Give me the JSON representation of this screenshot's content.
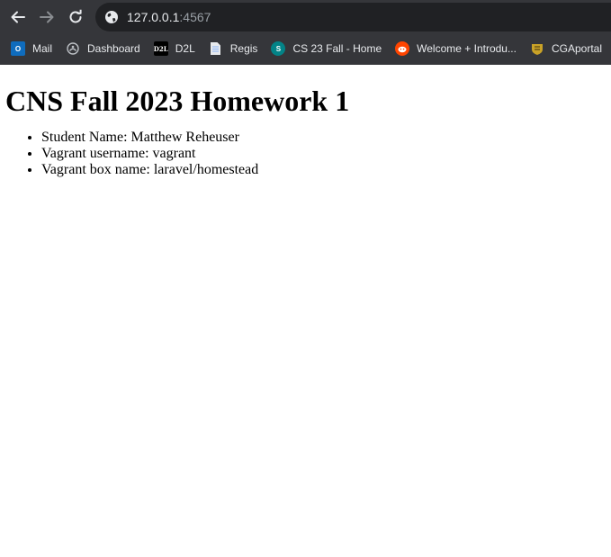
{
  "browser": {
    "url_host": "127.0.0.1",
    "url_port": ":4567",
    "bookmarks": [
      {
        "label": "Mail",
        "icon": "outlook-icon",
        "color": "#0f6cbd"
      },
      {
        "label": "Dashboard",
        "icon": "dashboard-icon",
        "color": "#bdc1c6"
      },
      {
        "label": "D2L",
        "icon": "d2l-icon",
        "color": "#000000"
      },
      {
        "label": "Regis",
        "icon": "document-icon",
        "color": "#8ab4f8"
      },
      {
        "label": "CS 23 Fall - Home",
        "icon": "sharepoint-icon",
        "color": "#038387"
      },
      {
        "label": "Welcome + Introdu...",
        "icon": "reddit-icon",
        "color": "#ff4500"
      },
      {
        "label": "CGAportal",
        "icon": "crest-icon",
        "color": "#c9a227"
      }
    ]
  },
  "page": {
    "title": "CNS Fall 2023 Homework 1",
    "items": [
      "Student Name: Matthew Reheuser",
      "Vagrant username: vagrant",
      "Vagrant box name: laravel/homestead"
    ]
  }
}
